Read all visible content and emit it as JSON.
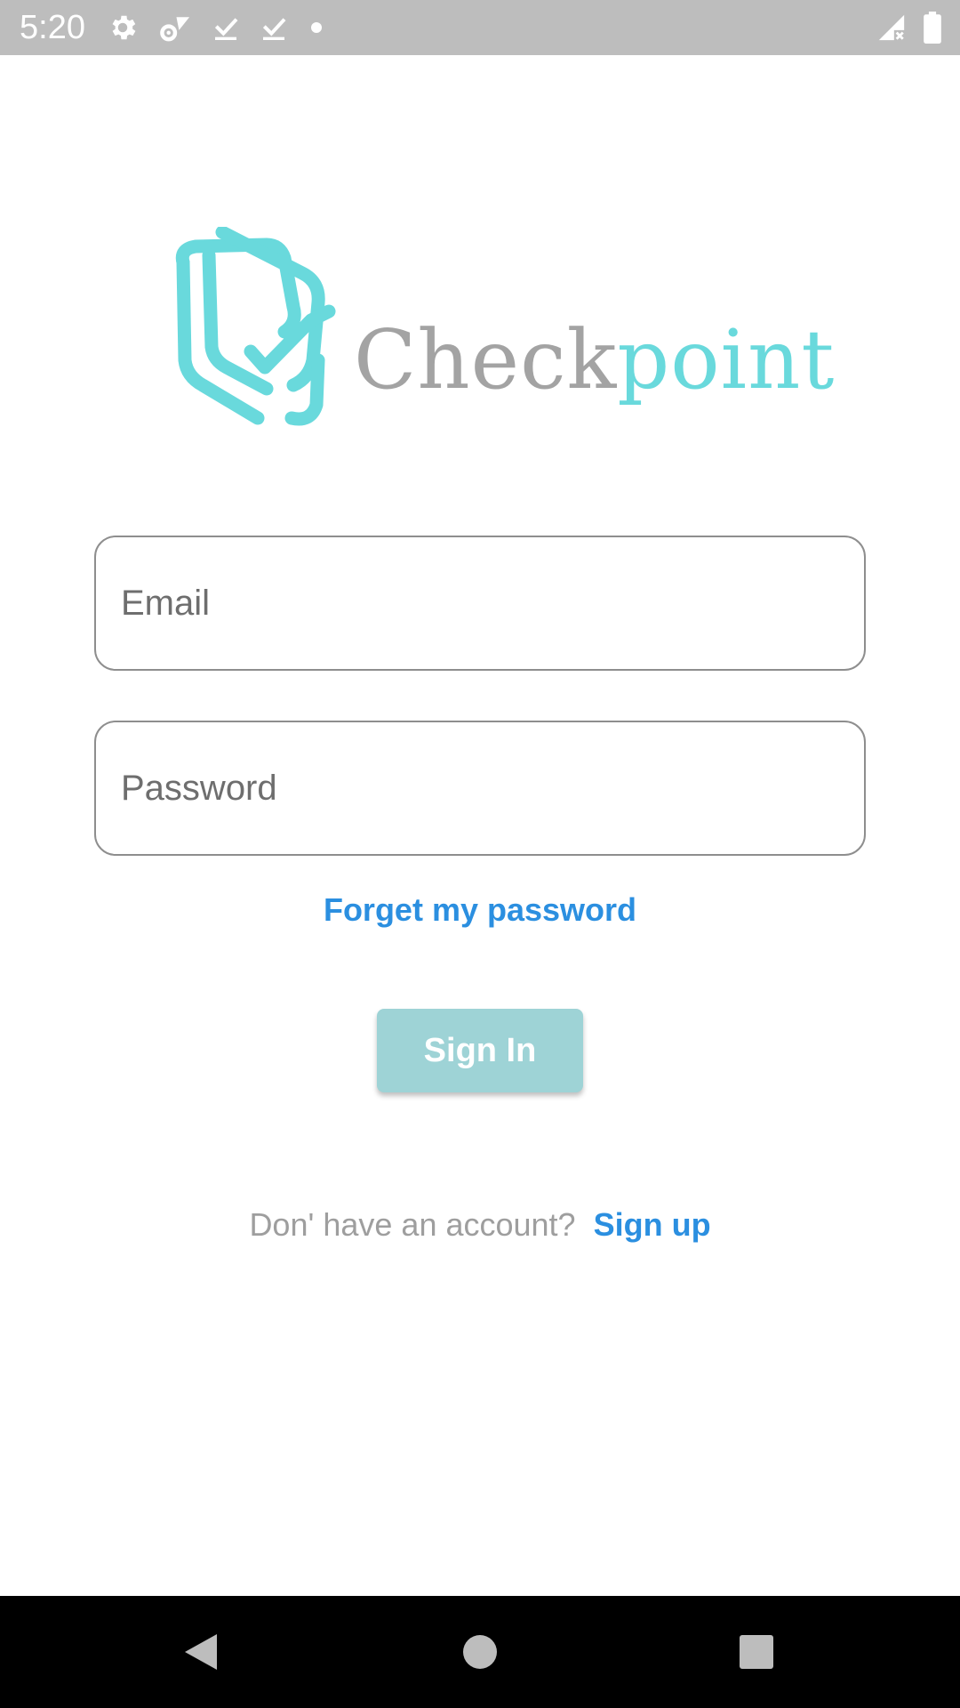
{
  "status_bar": {
    "time": "5:20",
    "icons": [
      "settings-icon",
      "signal-settings-icon",
      "download-done-icon",
      "download-done-icon",
      "dot-icon",
      "no-signal-icon",
      "battery-icon"
    ]
  },
  "logo": {
    "word_gray": "Check",
    "word_teal": "point",
    "colors": {
      "teal": "#69d9dc",
      "gray": "#a3a3a3"
    }
  },
  "form": {
    "email": {
      "value": "",
      "placeholder": "Email"
    },
    "password": {
      "value": "",
      "placeholder": "Password"
    },
    "forgot_label": "Forget my password",
    "signin_label": "Sign In"
  },
  "footer": {
    "prompt": "Don' have an account?",
    "signup_label": "Sign up"
  },
  "nav_bar": {
    "icons": [
      "back-icon",
      "home-icon",
      "recents-icon"
    ]
  },
  "colors": {
    "link": "#2b8fe0",
    "button": "#9ed3d6",
    "status_bar": "#bdbdbd"
  }
}
